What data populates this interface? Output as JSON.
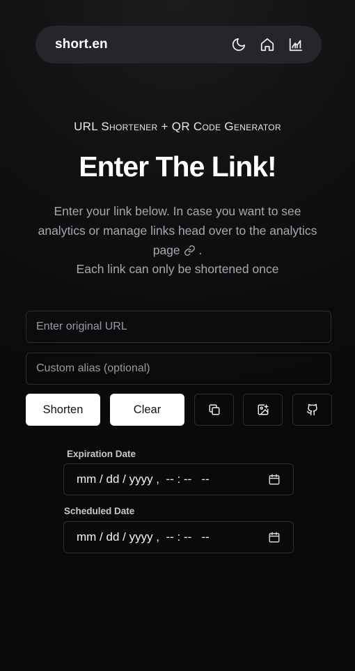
{
  "navbar": {
    "brand": "short.en",
    "icons": [
      "moon-icon",
      "home-icon",
      "chart-icon"
    ]
  },
  "hero": {
    "subtitle": "URL Shortener + QR Code Generator",
    "title": "Enter The Link!",
    "description_part1": "Enter your link below. In case you want to see analytics or manage links head over to the analytics page",
    "description_part2": ".",
    "note": "Each link can only be shortened once"
  },
  "form": {
    "url_placeholder": "Enter original URL",
    "url_value": "",
    "alias_placeholder": "Custom alias (optional)",
    "alias_value": "",
    "shorten_label": "Shorten",
    "clear_label": "Clear",
    "icon_buttons": [
      "copy-icon",
      "image-icon",
      "github-icon"
    ]
  },
  "dates": {
    "expiration_label": "Expiration Date",
    "expiration_value": "mm / dd / yyyy ,  -- : --   --",
    "scheduled_label": "Scheduled Date",
    "scheduled_value": "mm / dd / yyyy ,  -- : --   --"
  }
}
